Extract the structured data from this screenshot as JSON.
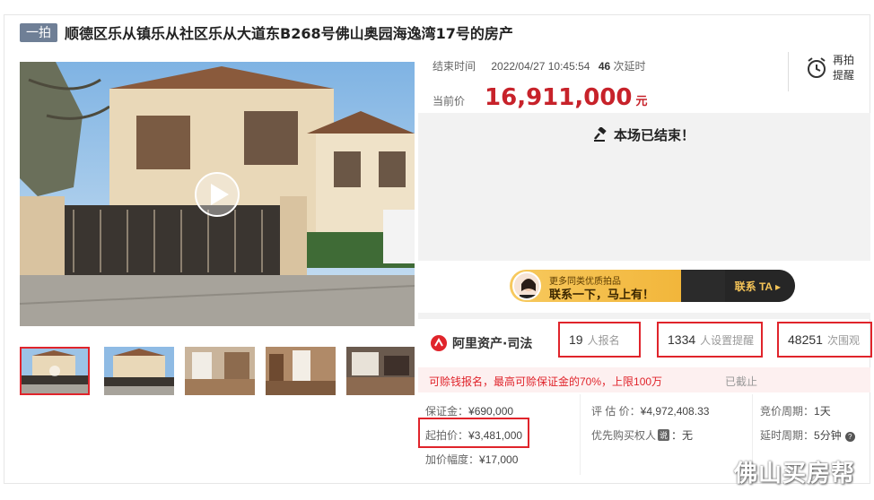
{
  "header": {
    "tag": "一拍",
    "title": "顺德区乐从镇乐从社区乐从大道东B268号佛山奥园海逸湾17号的房产"
  },
  "gallery": {
    "thumb_count": 5,
    "active_index": 0
  },
  "auction": {
    "end_label": "结束时间",
    "end_time": "2022/04/27 10:45:54",
    "delays_count": "46",
    "delays_label": "次延时",
    "current_price_label": "当前价",
    "current_price": "16,911,000",
    "currency_unit": "元",
    "remind_line1": "再拍",
    "remind_line2": "提醒",
    "ended_text": "本场已结束！"
  },
  "banner": {
    "small_text": "更多同类优质拍品",
    "big_text": "联系一下，马上有！",
    "button": "联系 TA"
  },
  "brand": {
    "name": "阿里资产·司法"
  },
  "stats": [
    {
      "num": "19",
      "unit": "人报名"
    },
    {
      "num": "1334",
      "unit": "人设置提醒"
    },
    {
      "num": "48251",
      "unit": "次围观"
    }
  ],
  "notice": {
    "text": "可赊钱报名，最高可赊保证金的70%，上限100万",
    "status": "已截止"
  },
  "details": {
    "deposit_label": "保证金：",
    "deposit_value": "¥690,000",
    "start_label": "起拍价：",
    "start_value": "¥3,481,000",
    "increment_label": "加价幅度：",
    "increment_value": "¥17,000",
    "appraisal_label": "评 估 价：",
    "appraisal_value": "¥4,972,408.33",
    "priority_label": "优先购买权人",
    "priority_tag": "说",
    "priority_value": "：无",
    "cycle_label": "竞价周期：",
    "cycle_value": "1天",
    "delay_label": "延时周期：",
    "delay_value": "5分钟"
  },
  "watermark": "佛山买房帮",
  "colors": {
    "accent_red": "#c7222a",
    "highlight_border": "#e0242b",
    "tag_bg": "#6f7f96"
  }
}
